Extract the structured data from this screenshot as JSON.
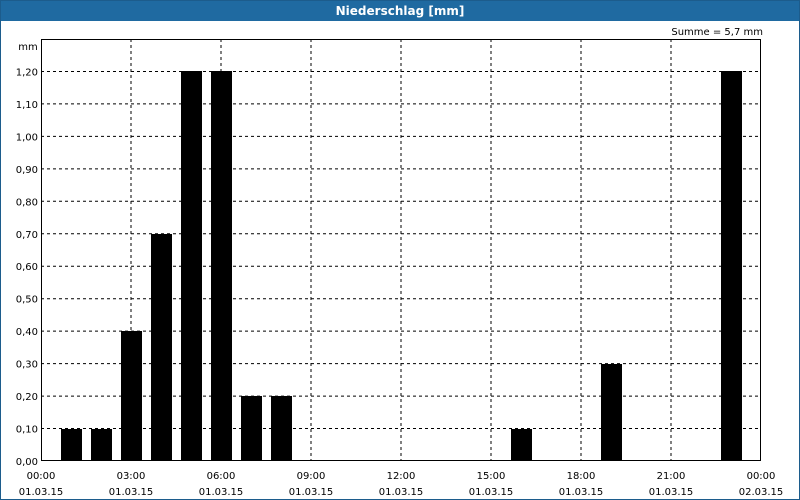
{
  "window": {
    "title": "Niederschlag [mm]"
  },
  "summary": {
    "text": "Summe = 5,7 mm"
  },
  "chart_data": {
    "type": "bar",
    "title": "Niederschlag [mm]",
    "ylabel": "mm",
    "ylim": [
      0,
      1.3
    ],
    "y_ticks": [
      "0,00",
      "0,10",
      "0,20",
      "0,30",
      "0,40",
      "0,50",
      "0,60",
      "0,70",
      "0,80",
      "0,90",
      "1,00",
      "1,10",
      "1,20"
    ],
    "x_ticks": [
      {
        "time": "00:00",
        "date": "01.03.15"
      },
      {
        "time": "03:00",
        "date": "01.03.15"
      },
      {
        "time": "06:00",
        "date": "01.03.15"
      },
      {
        "time": "09:00",
        "date": "01.03.15"
      },
      {
        "time": "12:00",
        "date": "01.03.15"
      },
      {
        "time": "15:00",
        "date": "01.03.15"
      },
      {
        "time": "18:00",
        "date": "01.03.15"
      },
      {
        "time": "21:00",
        "date": "01.03.15"
      },
      {
        "time": "00:00",
        "date": "02.03.15"
      }
    ],
    "x_range_hours": [
      0,
      24
    ],
    "bars": [
      {
        "hour": 1,
        "value": 0.1
      },
      {
        "hour": 2,
        "value": 0.1
      },
      {
        "hour": 3,
        "value": 0.4
      },
      {
        "hour": 4,
        "value": 0.7
      },
      {
        "hour": 5,
        "value": 1.2
      },
      {
        "hour": 6,
        "value": 1.2
      },
      {
        "hour": 7,
        "value": 0.2
      },
      {
        "hour": 8,
        "value": 0.2
      },
      {
        "hour": 16,
        "value": 0.1
      },
      {
        "hour": 19,
        "value": 0.3
      },
      {
        "hour": 23,
        "value": 1.2
      }
    ],
    "bar_color": "#000000",
    "grid": true,
    "grid_style": "dashed"
  }
}
